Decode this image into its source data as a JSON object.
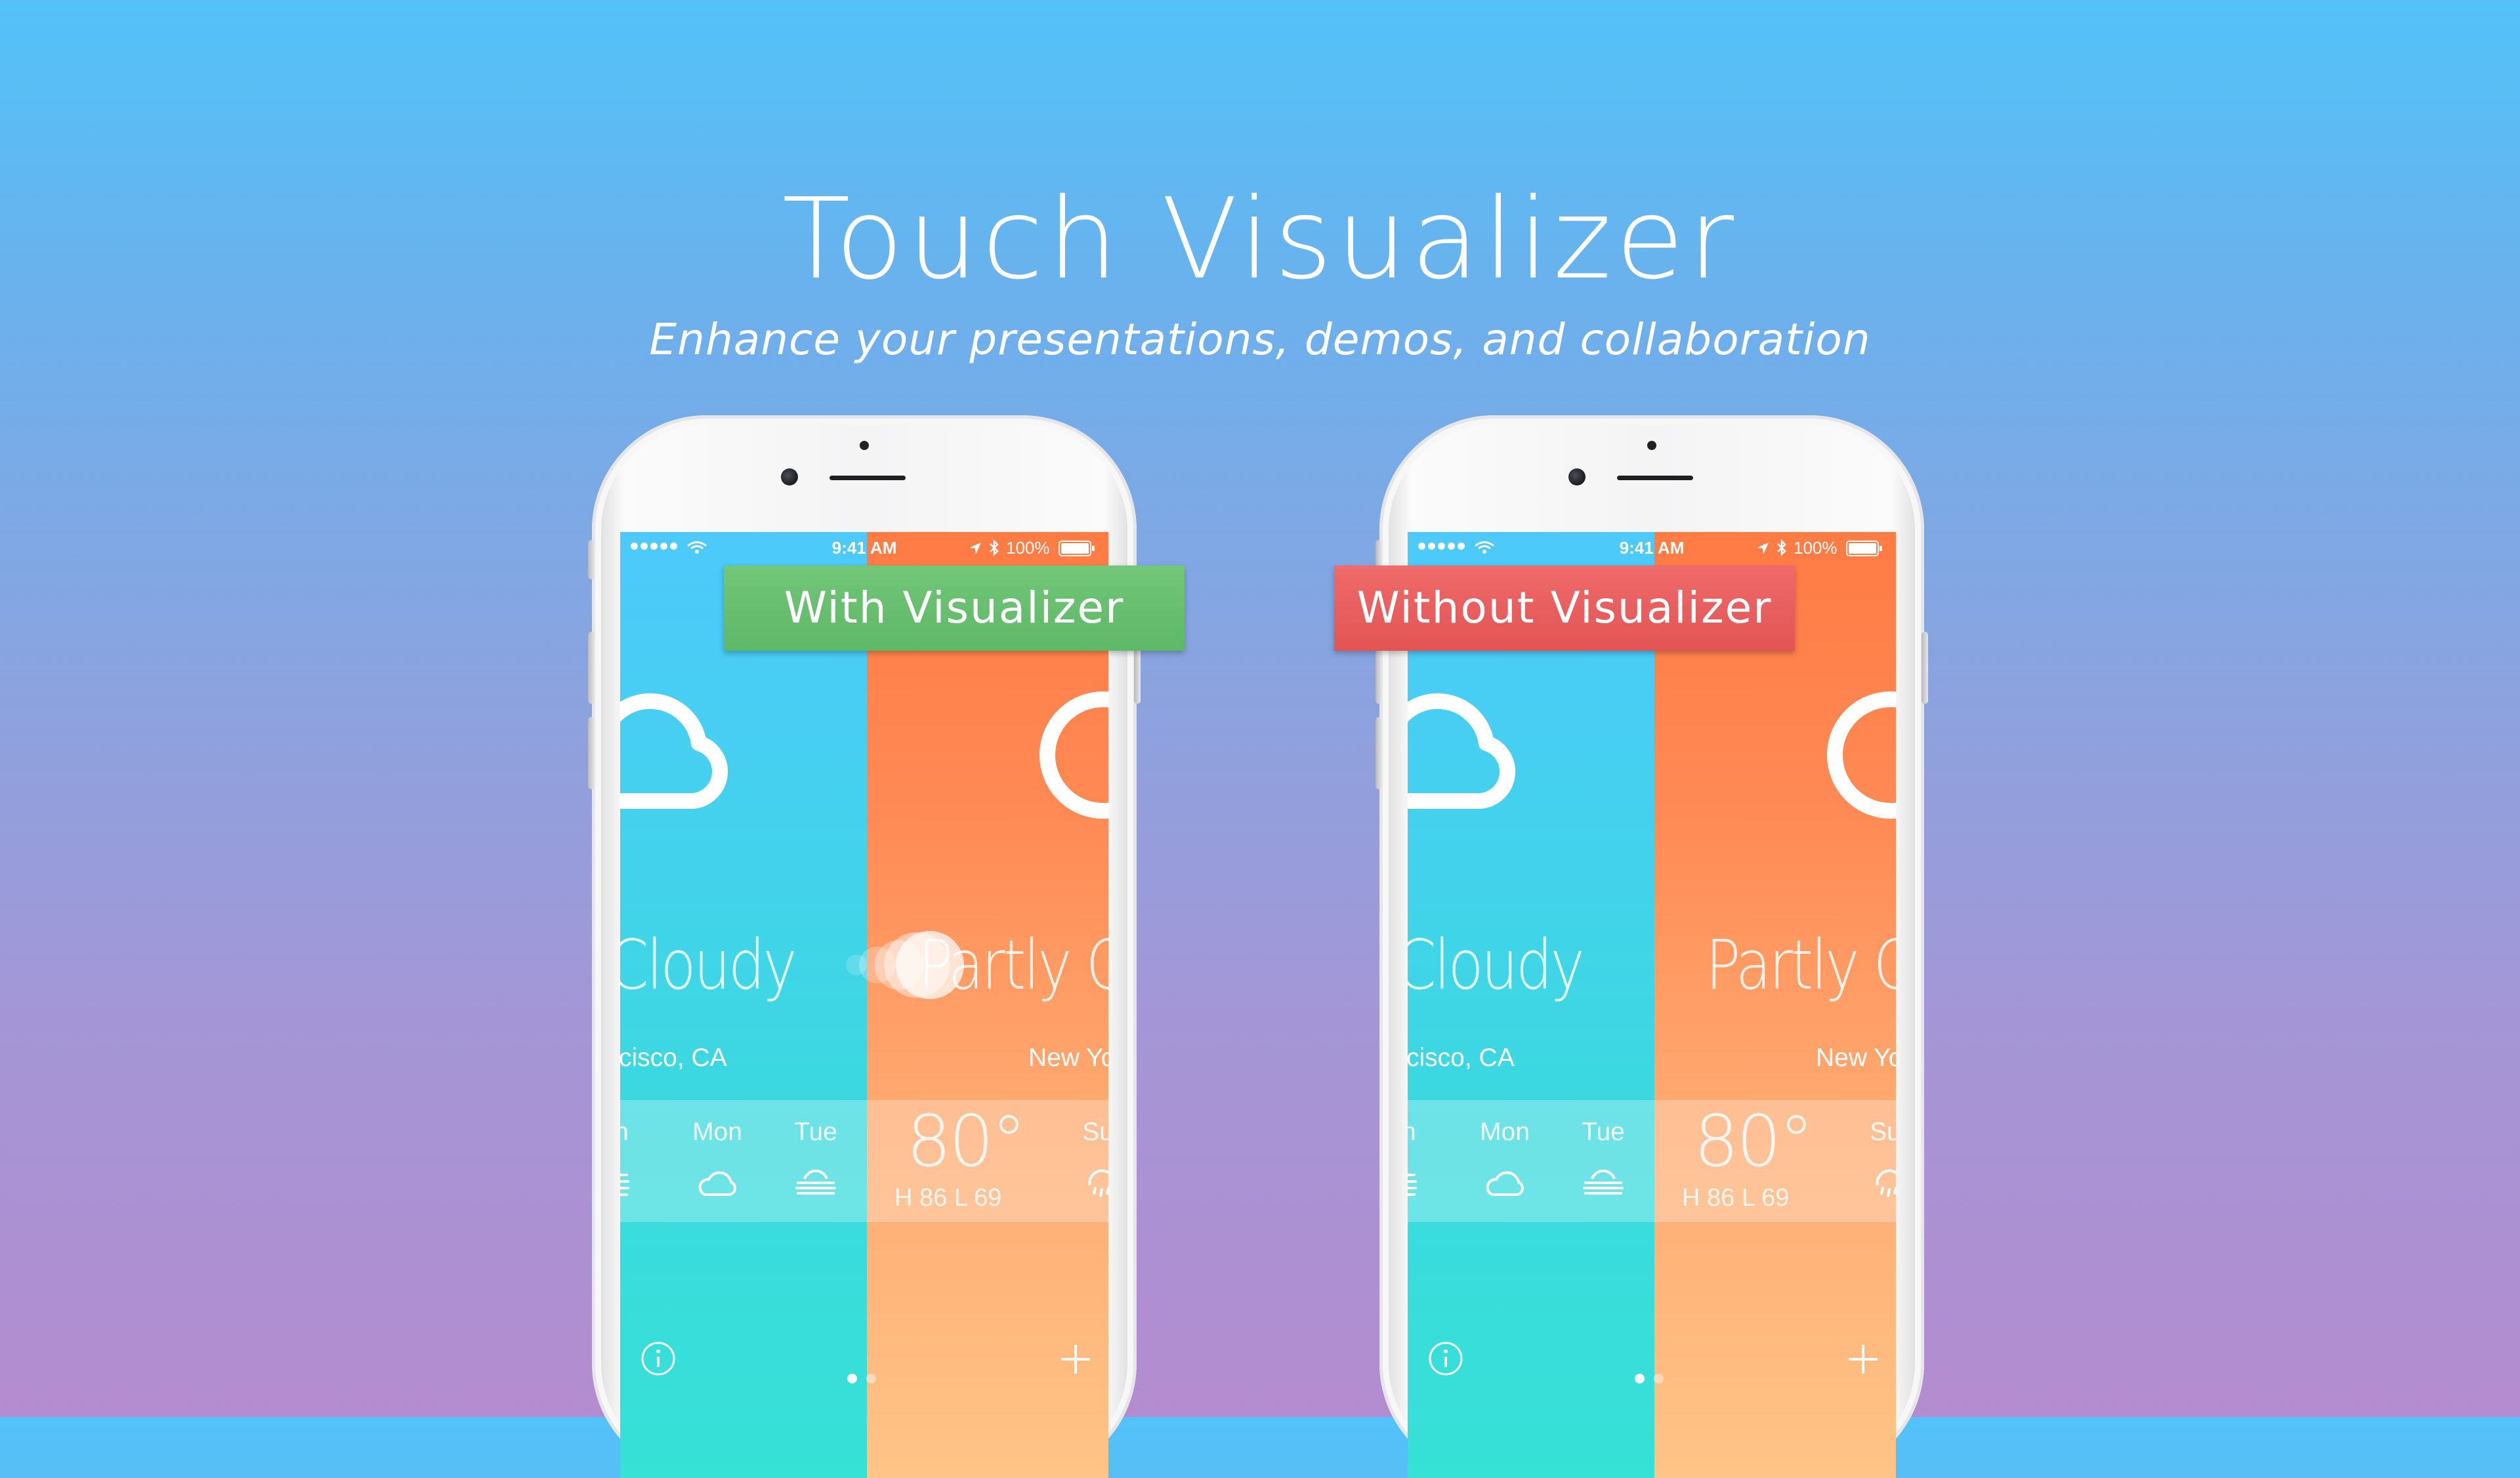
{
  "header": {
    "title": "Touch Visualizer",
    "subtitle": "Enhance your presentations, demos, and collaboration"
  },
  "labels": {
    "with": "With Visualizer",
    "without": "Without Visualizer"
  },
  "status_bar": {
    "time": "9:41 AM",
    "battery": "100%"
  },
  "cities": {
    "first": {
      "condition": "Cloudy",
      "city": "cisco, CA",
      "days": [
        "n",
        "Mon",
        "Tue"
      ]
    },
    "second": {
      "condition": "Partly C",
      "city": "New Yo",
      "temperature": "80°",
      "high_low": "H 86  L 69",
      "day": "Su"
    }
  },
  "colors": {
    "blue_panel": "#4dc9fb",
    "orange_panel": "#ff7b44",
    "with_label": "#5eb866",
    "without_label": "#e25454"
  }
}
